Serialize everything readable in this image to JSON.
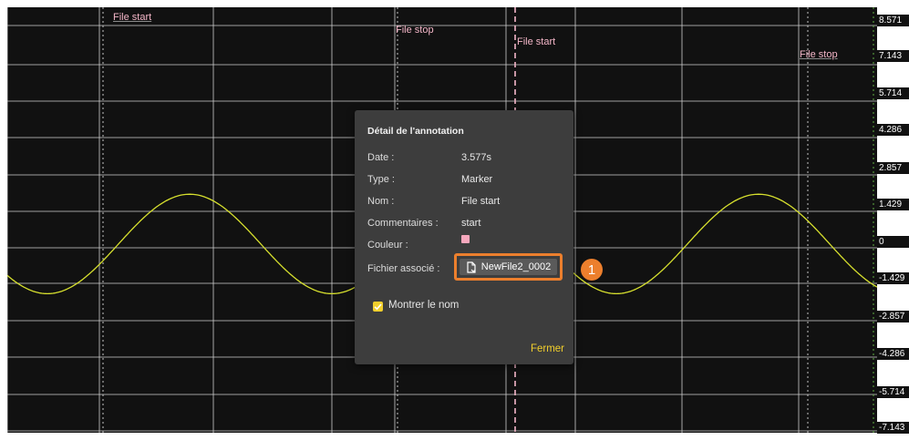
{
  "plot": {
    "y_axis_labels": [
      "8.571",
      "7.143",
      "5.714",
      "4.286",
      "2.857",
      "1.429",
      "0",
      "-1.429",
      "-2.857",
      "-4.286",
      "-5.714",
      "-7.143"
    ],
    "annotations": [
      {
        "label": "File start"
      },
      {
        "label": "File stop"
      },
      {
        "label": "File start"
      },
      {
        "label": "File stop"
      }
    ],
    "signal": {
      "type": "sine",
      "color": "#d7e02e",
      "peak": 2.1,
      "trough": -1.8
    }
  },
  "dialog": {
    "title": "Détail de l'annotation",
    "rows": [
      {
        "label": "Date :",
        "value": "3.577s"
      },
      {
        "label": "Type :",
        "value": "Marker"
      },
      {
        "label": "Nom :",
        "value": "File start"
      },
      {
        "label": "Commentaires :",
        "value": "start"
      },
      {
        "label": "Couleur :",
        "value": ""
      },
      {
        "label": "Fichier associé :",
        "value": ""
      }
    ],
    "color_value": "#f7a8bd",
    "file_button_label": "NewFile2_0002",
    "file_icon": "file-link-icon",
    "checkbox_label": "Montrer le nom",
    "checkbox_checked": true,
    "close_label": "Fermer"
  },
  "callout_badge": "1",
  "colors": {
    "background": "#111111",
    "grid": "#cfcfcf",
    "marker": "#f4b6c8",
    "accent": "#f2cf2c",
    "highlight": "#ec7f2d"
  }
}
